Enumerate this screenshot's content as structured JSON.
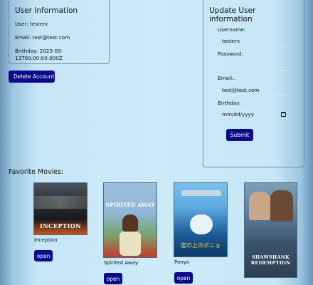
{
  "user_info": {
    "title": "User Information",
    "user_line": "User: testerx",
    "email_line": "Email: test@test.com",
    "birthday_line": "Birthday: 2023-09-13T00:00:00.000Z"
  },
  "delete_button": "Delete Account",
  "update_form": {
    "title": "Update User information",
    "username_label": "Username:",
    "username_value": "testerx",
    "password_label": "Password:",
    "password_value": "",
    "email_label": "Email:.",
    "email_value": "test@test.com",
    "birthday_label": "Birthday:",
    "birthday_placeholder": "mm/dd/yyyy",
    "submit_label": "Submit"
  },
  "favorites": {
    "title": "Favorite Movies:",
    "open_label": "open",
    "movies": [
      {
        "title": "Inception",
        "poster_text": "INCEPTION",
        "poster_colors": [
          "#2b3036",
          "#121416",
          "#c4571e"
        ]
      },
      {
        "title": "Spirited Away",
        "poster_text": "SPIRITED AWAY",
        "poster_colors": [
          "#8fb7d8",
          "#c23a2c",
          "#e8e2c0"
        ]
      },
      {
        "title": "Ponyo",
        "poster_text": "崖の上のポニョ",
        "poster_colors": [
          "#5aa7dd",
          "#1b5a95",
          "#e9f2f6"
        ]
      },
      {
        "title": "",
        "poster_text": "SHAWSHANK REDEMPTION",
        "poster_colors": [
          "#5a7d9a",
          "#2d3f52",
          "#d8c8a8"
        ]
      }
    ]
  }
}
